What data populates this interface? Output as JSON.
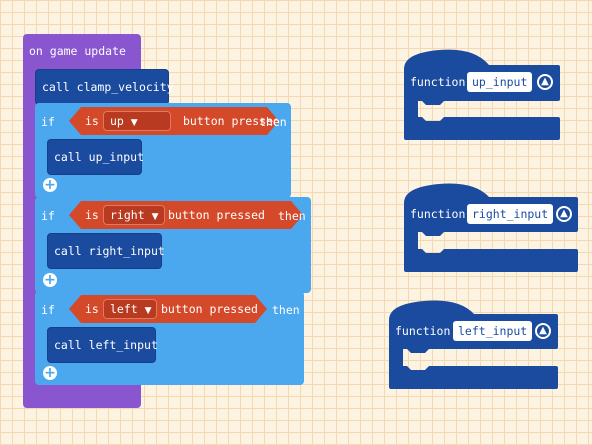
{
  "workspace": {
    "event_block": {
      "label": "on game update",
      "color": "#8a56cf",
      "statements": [
        {
          "type": "call",
          "label": "call",
          "function": "clamp_velocity"
        },
        {
          "type": "if",
          "if_label": "if",
          "then_label": "then",
          "condition": {
            "is_label": "is",
            "button": "up",
            "suffix": "button pressed"
          },
          "body": {
            "label": "call",
            "function": "up_input"
          }
        },
        {
          "type": "if",
          "if_label": "if",
          "then_label": "then",
          "condition": {
            "is_label": "is",
            "button": "right",
            "suffix": "button pressed"
          },
          "body": {
            "label": "call",
            "function": "right_input"
          }
        },
        {
          "type": "if",
          "if_label": "if",
          "then_label": "then",
          "condition": {
            "is_label": "is",
            "button": "left",
            "suffix": "button pressed"
          },
          "body": {
            "label": "call",
            "function": "left_input"
          }
        }
      ]
    },
    "functions": [
      {
        "label": "function",
        "name": "up_input"
      },
      {
        "label": "function",
        "name": "right_input"
      },
      {
        "label": "function",
        "name": "left_input"
      }
    ],
    "icons": {
      "add": "plus-circle-icon",
      "collapse": "chevron-up-circle-icon",
      "dropdown": "caret-down-icon"
    },
    "colors": {
      "loops": "#8a56cf",
      "functions": "#1b4b9f",
      "logic": "#4ba8ee",
      "controller": "#d5492b",
      "background": "#fdf3e3"
    }
  }
}
